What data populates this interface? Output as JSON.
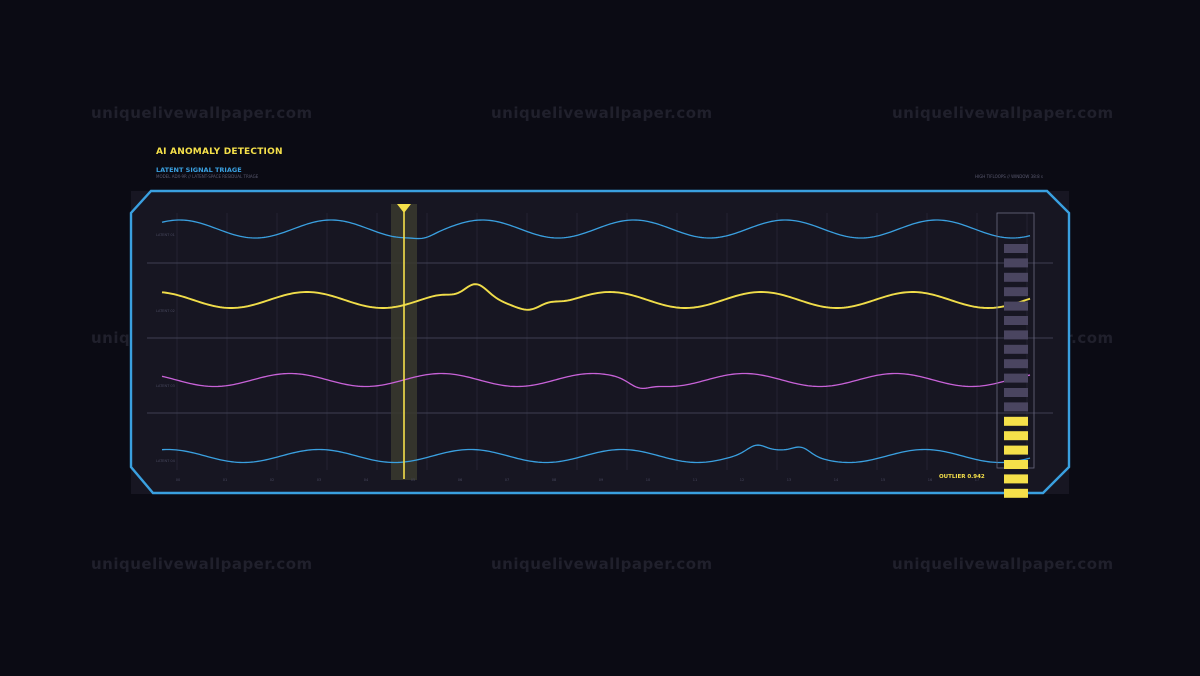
{
  "watermark": "uniquelivewallpaper.com",
  "header": {
    "title": "AI ANOMALY DETECTION",
    "subtitle": "LATENT SIGNAL TRIAGE",
    "meta_left": "MODEL ADX-9R  //  LATENT-SPACE RESIDUAL TRIAGE",
    "meta_right": "HIGH TIFLOOPS  //  WINDOW 38:8 s"
  },
  "panel": {
    "row_labels": [
      "LATENT 01",
      "LATENT 02",
      "LATENT 03",
      "LATENT 04"
    ],
    "ticks": [
      "00",
      "01",
      "02",
      "03",
      "04",
      "05",
      "06",
      "07",
      "08",
      "09",
      "10",
      "11",
      "12",
      "13",
      "14",
      "15",
      "16",
      "17"
    ],
    "outlier_label": "OUTLIER 0.942",
    "outlier_score": 0.942,
    "meter_segments_total": 18,
    "meter_segments_active": 6
  },
  "colors": {
    "background": "#0b0b14",
    "frame": "#3aa0e0",
    "accent_yellow": "#f5e04a",
    "signal_blue": "#3aa0e0",
    "signal_yellow": "#f0dd4a",
    "signal_magenta": "#c862d8",
    "meter_inactive": "#4a4560"
  },
  "signals": [
    {
      "name": "LATENT 01",
      "color": "signal_blue"
    },
    {
      "name": "LATENT 02",
      "color": "signal_yellow"
    },
    {
      "name": "LATENT 03",
      "color": "signal_magenta"
    },
    {
      "name": "LATENT 04",
      "color": "signal_blue"
    }
  ]
}
